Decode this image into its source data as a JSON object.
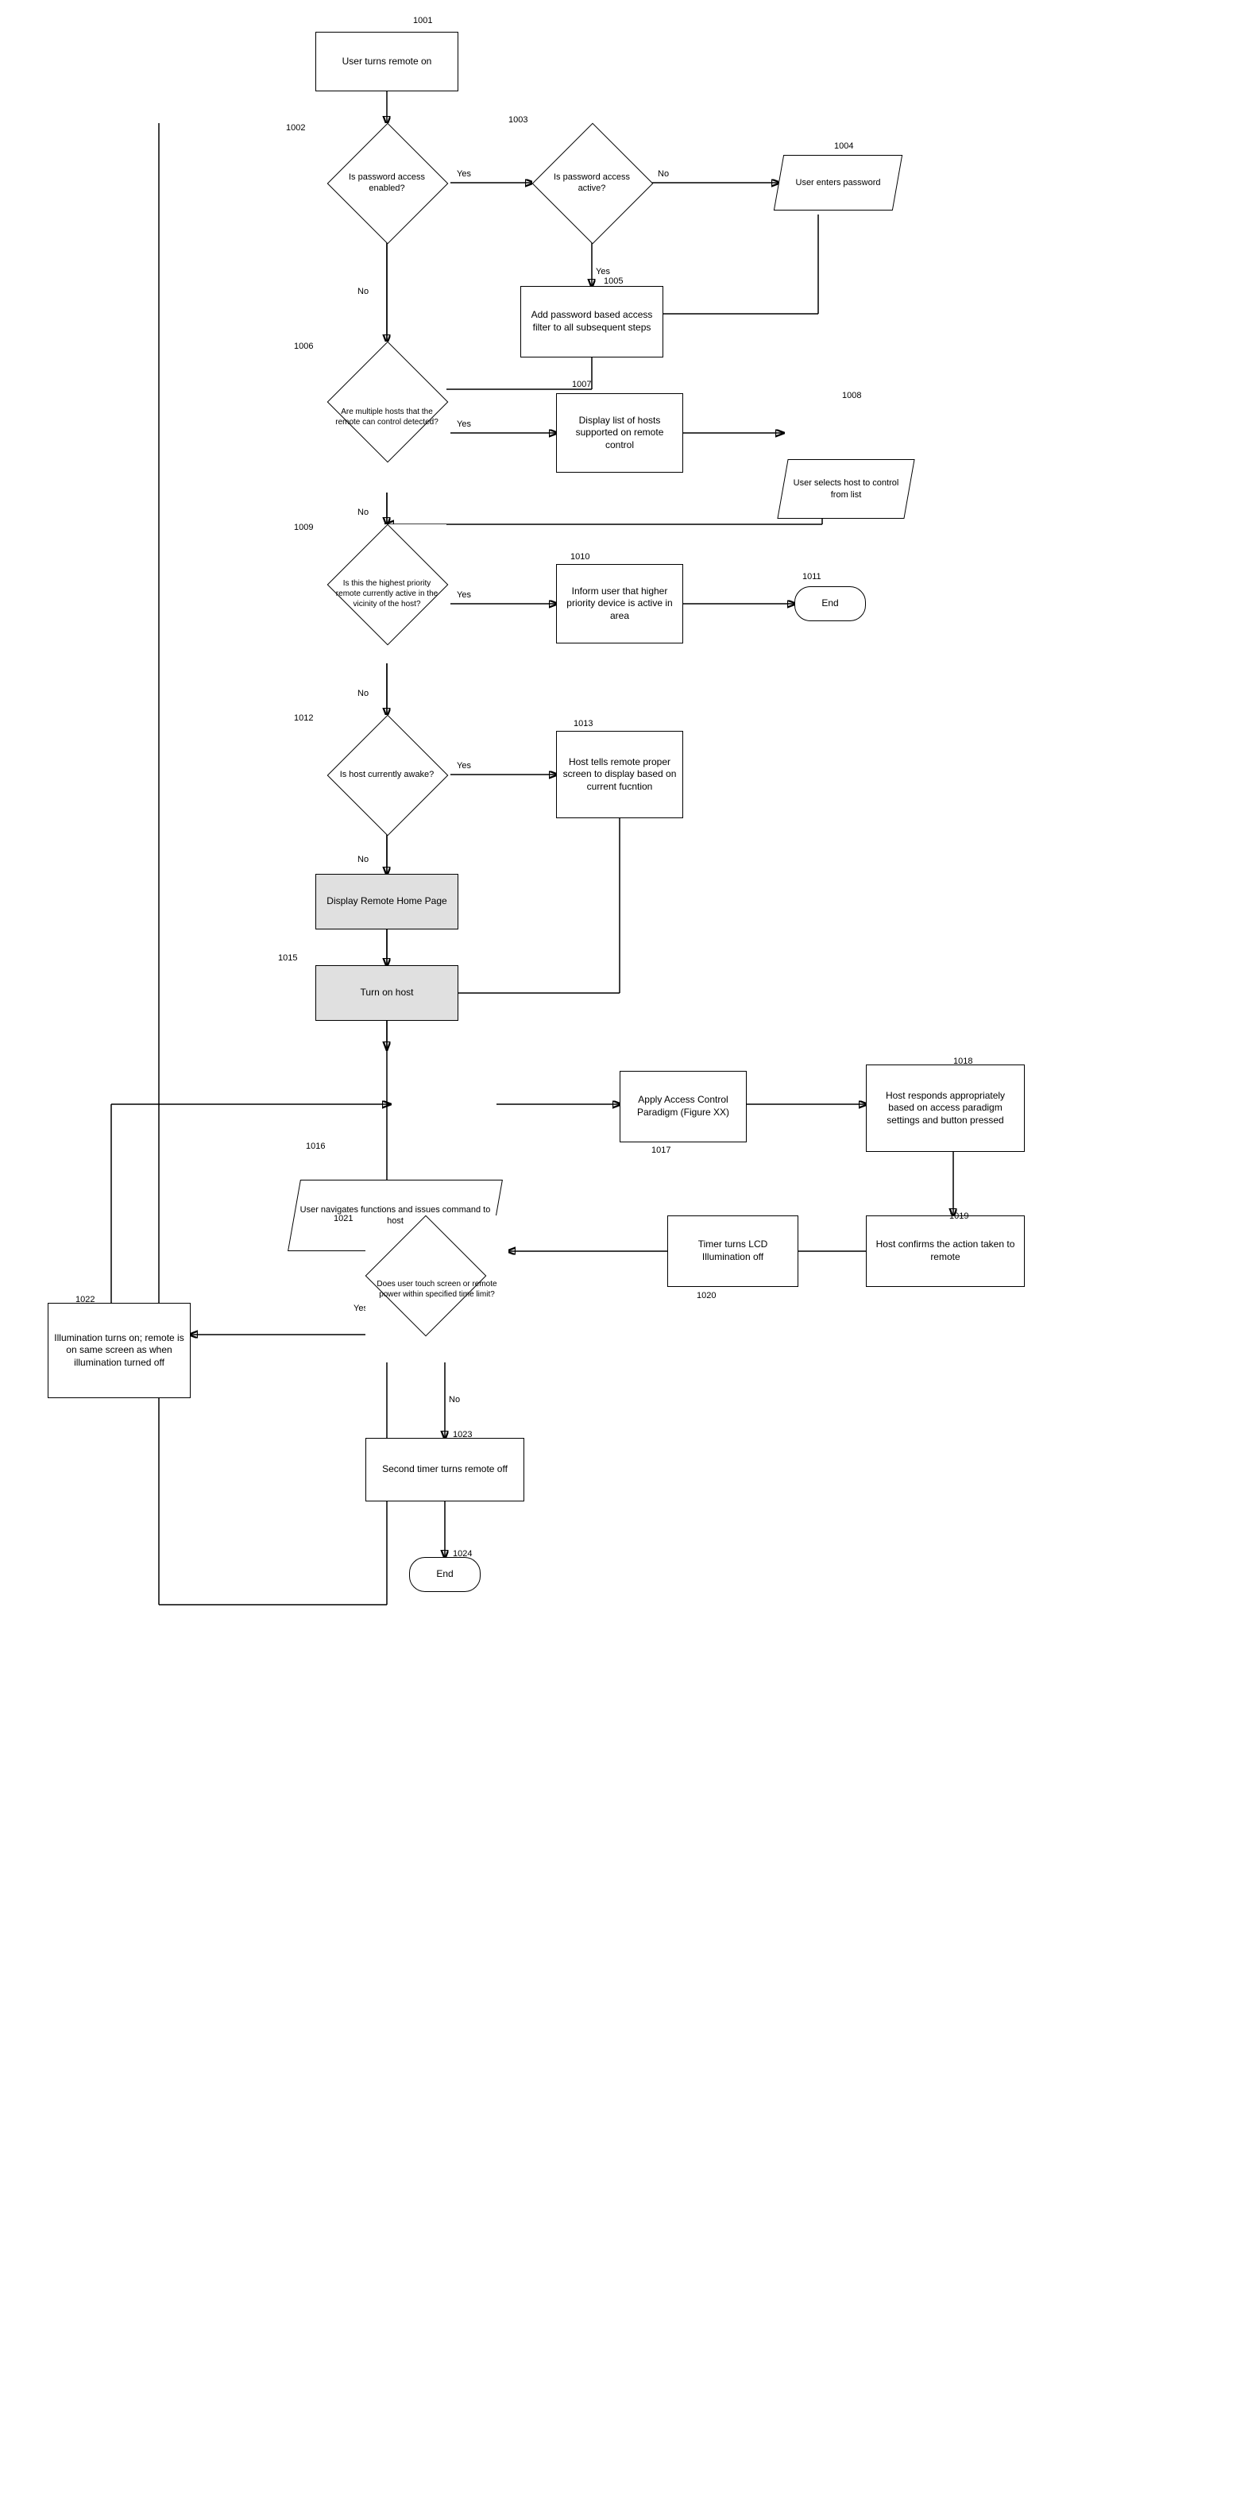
{
  "nodes": {
    "n1001": {
      "id": "1001",
      "label": "User turns remote on",
      "type": "rect"
    },
    "n1002": {
      "id": "1002",
      "label": "Is password access enabled?",
      "type": "diamond"
    },
    "n1003": {
      "id": "1003",
      "label": "Is password access active?",
      "type": "diamond"
    },
    "n1004": {
      "id": "1004",
      "label": "User enters password",
      "type": "parallelogram"
    },
    "n1005": {
      "id": "1005",
      "label": "Add password based access filter to all subsequent steps",
      "type": "rect"
    },
    "n1006": {
      "id": "1006",
      "label": "Are multiple hosts that the remote can control detected?",
      "type": "diamond"
    },
    "n1007": {
      "id": "1007",
      "label": "Display list of hosts supported on remote control",
      "type": "rect"
    },
    "n1008": {
      "id": "1008",
      "label": "User selects host to control from list",
      "type": "parallelogram"
    },
    "n1009": {
      "id": "1009",
      "label": "Is this the highest priority remote currently active in the vicinity of the host?",
      "type": "diamond"
    },
    "n1010": {
      "id": "1010",
      "label": "Inform user that higher priority device is active in area",
      "type": "rect"
    },
    "n1011": {
      "id": "1011",
      "label": "End",
      "type": "terminal"
    },
    "n1012": {
      "id": "1012",
      "label": "Is host currently awake?",
      "type": "diamond"
    },
    "n1013": {
      "id": "1013",
      "label": "Host tells remote proper screen to display based on current fucntion",
      "type": "rect"
    },
    "n1014": {
      "id": "1014",
      "label": "Display Remote Home Page",
      "type": "rect"
    },
    "n1015": {
      "id": "1015",
      "label": "Turn on host",
      "type": "rect"
    },
    "n1016": {
      "id": "1016",
      "label": "User navigates functions and issues command to host",
      "type": "parallelogram"
    },
    "n1017": {
      "id": "1017",
      "label": "Apply Access Control Paradigm (Figure XX)",
      "type": "rect"
    },
    "n1018": {
      "id": "1018",
      "label": "Host responds appropriately based on access paradigm settings and button pressed",
      "type": "rect"
    },
    "n1019": {
      "id": "1019",
      "label": "Host confirms the action taken to remote",
      "type": "rect"
    },
    "n1020": {
      "id": "1020",
      "label": "Timer turns LCD Illumination off",
      "type": "rect"
    },
    "n1021": {
      "id": "1021",
      "label": "Does user touch screen or remote power within specified time limit?",
      "type": "diamond"
    },
    "n1022": {
      "id": "1022",
      "label": "Illumination turns on; remote is on same screen as when illumination turned off",
      "type": "rect"
    },
    "n1023": {
      "id": "1023",
      "label": "Second timer turns remote off",
      "type": "rect"
    },
    "n1024": {
      "id": "1024",
      "label": "End",
      "type": "terminal"
    }
  },
  "flow_labels": {
    "yes": "Yes",
    "no": "No"
  }
}
